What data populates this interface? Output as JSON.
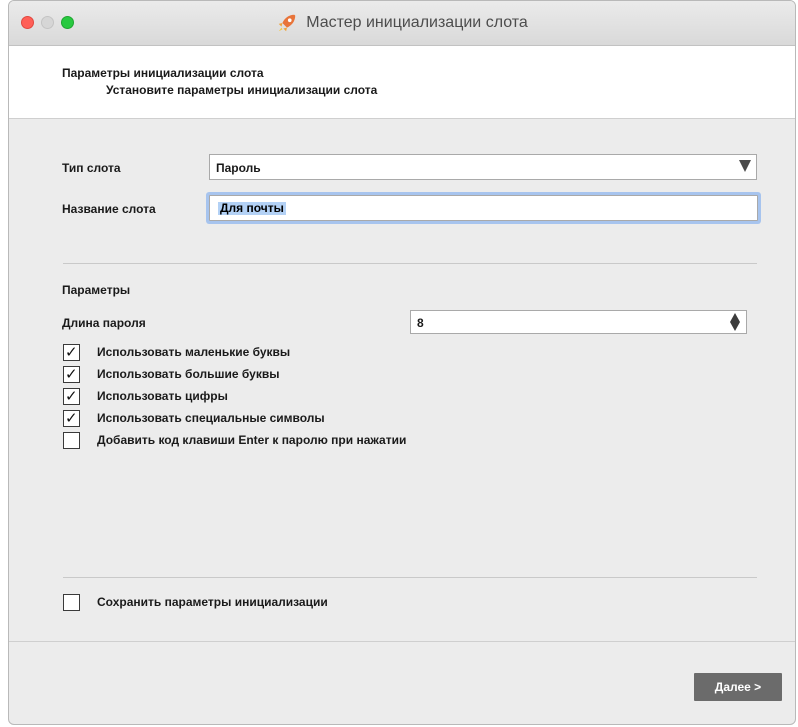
{
  "window": {
    "title": "Мастер инициализации слота",
    "icon": "rocket-icon"
  },
  "header": {
    "title": "Параметры инициализации слота",
    "subtitle": "Установите параметры инициализации слота"
  },
  "slot": {
    "type_label": "Тип слота",
    "type_value": "Пароль",
    "name_label": "Название слота",
    "name_value": "Для почты"
  },
  "params": {
    "section_label": "Параметры",
    "length_label": "Длина пароля",
    "length_value": "8",
    "options": [
      {
        "label": "Использовать маленькие буквы",
        "checked": true
      },
      {
        "label": "Использовать большие буквы",
        "checked": true
      },
      {
        "label": "Использовать цифры",
        "checked": true
      },
      {
        "label": "Использовать специальные символы",
        "checked": true
      },
      {
        "label": "Добавить код клавиши Enter к паролю при нажатии",
        "checked": false
      }
    ]
  },
  "save": {
    "label": "Сохранить параметры инициализации",
    "checked": false
  },
  "footer": {
    "next_label": "Далее >"
  },
  "colors": {
    "next_button": "#6b6b6b",
    "focus_ring": "#a7c4ee",
    "close": "#ff5f57",
    "maximize": "#28c940"
  }
}
